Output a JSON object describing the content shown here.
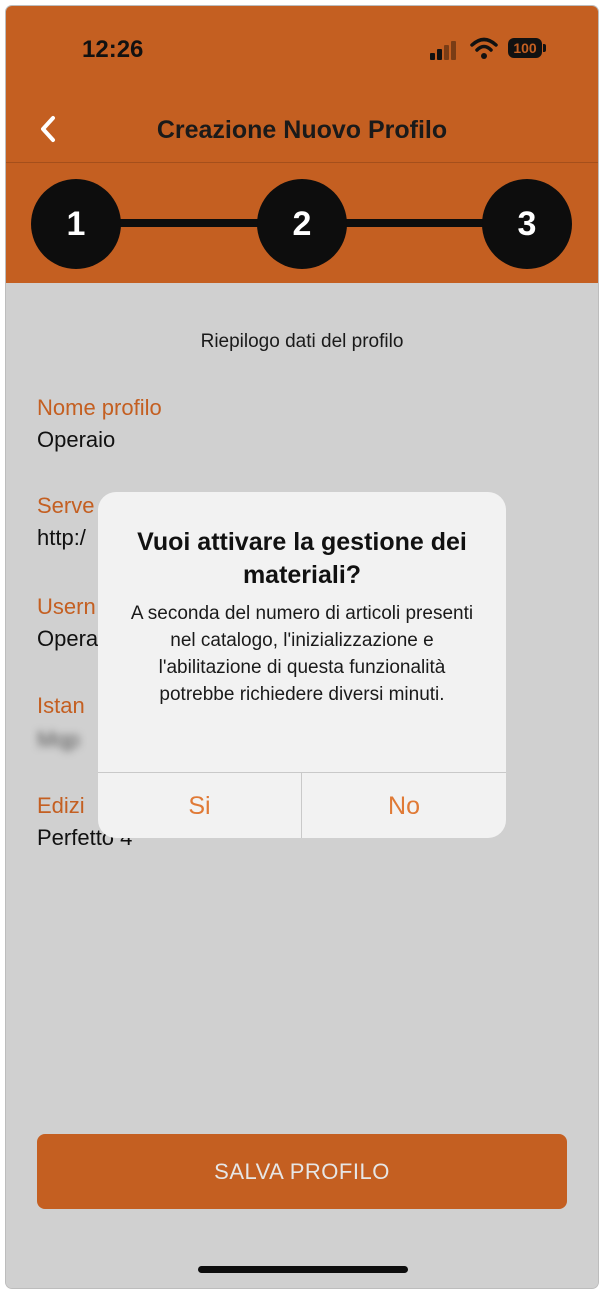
{
  "status_bar": {
    "time": "12:26",
    "battery": "100"
  },
  "nav": {
    "title": "Creazione Nuovo Profilo"
  },
  "stepper": {
    "steps": [
      "1",
      "2",
      "3"
    ]
  },
  "summary": {
    "heading": "Riepilogo dati del profilo",
    "fields": [
      {
        "label": "Nome profilo",
        "value": "Operaio"
      },
      {
        "label": "Serve",
        "value": "http:/"
      },
      {
        "label": "Usern",
        "value": "Opera"
      },
      {
        "label": "Istan",
        "value": "Mqp"
      },
      {
        "label": "Edizi",
        "value": "Perfetto 4"
      }
    ]
  },
  "save_button": {
    "label": "SALVA PROFILO"
  },
  "alert": {
    "title": "Vuoi attivare la gestione dei materiali?",
    "message": "A seconda del numero di articoli presenti nel catalogo, l'inizializzazione e l'abilitazione di questa funzionalità potrebbe richiedere diversi minuti.",
    "yes_label": "Si",
    "no_label": "No"
  },
  "colors": {
    "accent": "#c45f21",
    "alert_button": "#e07a36",
    "background": "#d0d0d0"
  }
}
